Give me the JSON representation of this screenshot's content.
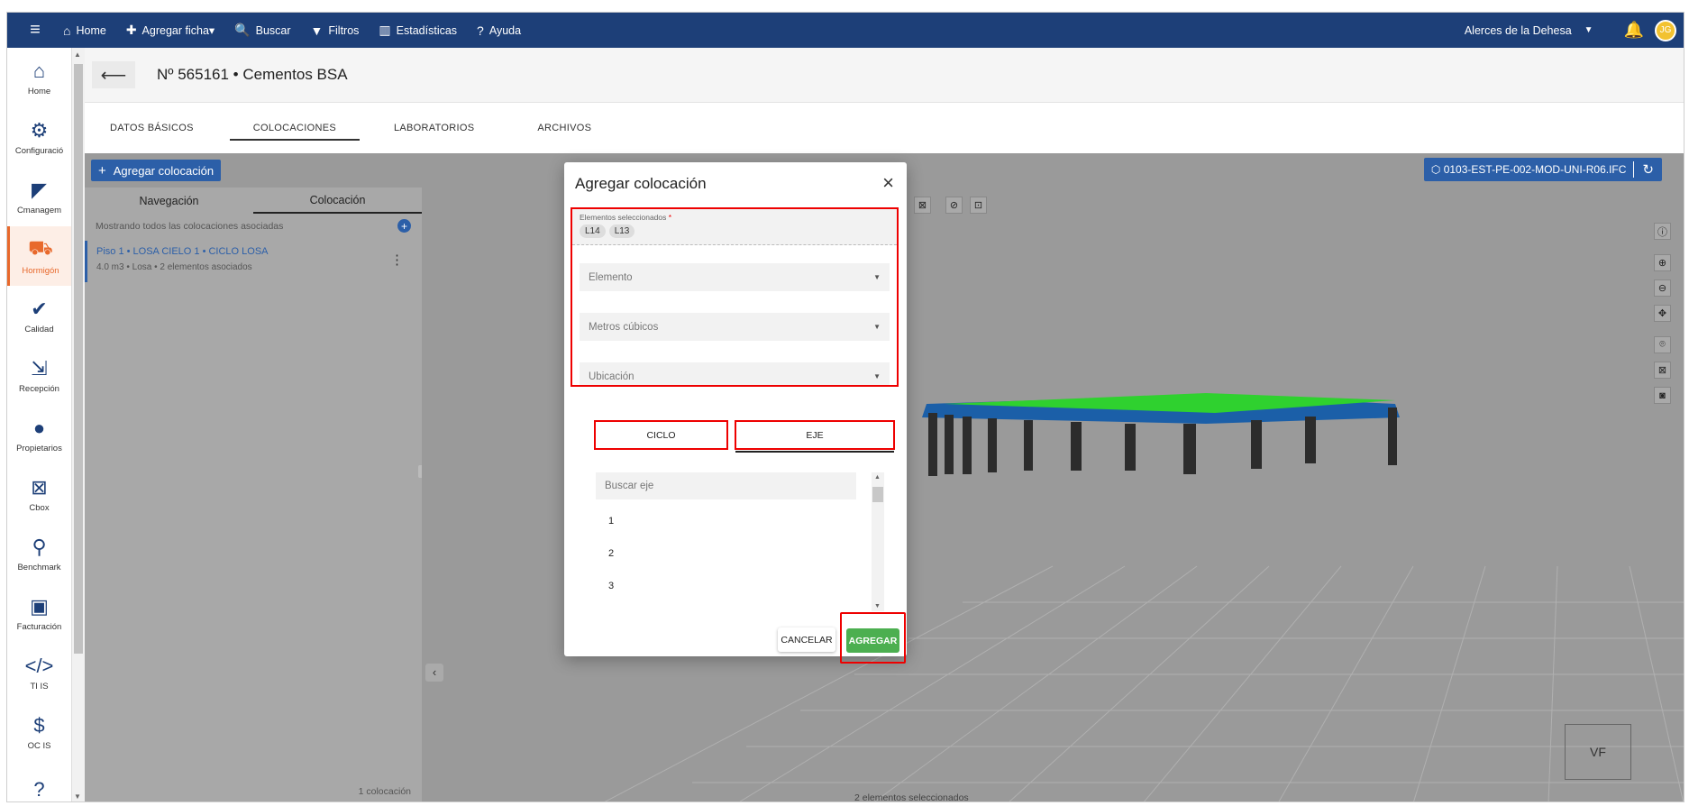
{
  "topbar": {
    "items": [
      {
        "icon": "home-icon",
        "glyph": "⌂",
        "label": "Home"
      },
      {
        "icon": "plus-icon",
        "glyph": "✚",
        "label": "Agregar ficha"
      },
      {
        "icon": "search-icon",
        "glyph": "🔍",
        "label": "Buscar"
      },
      {
        "icon": "filter-icon",
        "glyph": "▼",
        "label": "Filtros"
      },
      {
        "icon": "stats-icon",
        "glyph": "▥",
        "label": "Estadísticas"
      },
      {
        "icon": "help-icon",
        "glyph": "?",
        "label": "Ayuda"
      }
    ],
    "project": "Alerces de la Dehesa",
    "avatar": "JG"
  },
  "sidebar": {
    "items": [
      {
        "icon": "home-icon",
        "glyph": "⌂",
        "label": "Home"
      },
      {
        "icon": "gear-icon",
        "glyph": "⚙",
        "label": "Configuració"
      },
      {
        "icon": "cmanagement-icon",
        "glyph": "◤",
        "label": "Cmanagem"
      },
      {
        "icon": "wheelbarrow-icon",
        "glyph": "⛟",
        "label": "Hormigón",
        "active": true
      },
      {
        "icon": "check-icon",
        "glyph": "✔",
        "label": "Calidad"
      },
      {
        "icon": "reception-icon",
        "glyph": "⇲",
        "label": "Recepción"
      },
      {
        "icon": "owner-icon",
        "glyph": "●",
        "label": "Propietarios"
      },
      {
        "icon": "cbox-icon",
        "glyph": "⊠",
        "label": "Cbox"
      },
      {
        "icon": "benchmark-icon",
        "glyph": "⚲",
        "label": "Benchmark"
      },
      {
        "icon": "billing-icon",
        "glyph": "▣",
        "label": "Facturación"
      },
      {
        "icon": "code-icon",
        "glyph": "</>",
        "label": "TI IS"
      },
      {
        "icon": "dollar-icon",
        "glyph": "$",
        "label": "OC IS"
      },
      {
        "icon": "help-icon",
        "glyph": "?",
        "label": ""
      }
    ]
  },
  "header": {
    "title": "Nº 565161 • Cementos BSA"
  },
  "tabs": [
    "DATOS BÁSICOS",
    "COLOCACIONES",
    "LABORATORIOS",
    "ARCHIVOS"
  ],
  "toolbar": {
    "add_label": "Agregar colocación",
    "model_name": "0103-EST-PE-002-MOD-UNI-R06.IFC"
  },
  "panel": {
    "tabs": [
      "Navegación",
      "Colocación"
    ],
    "info": "Mostrando todos las colocaciones asociadas",
    "item_title": "Piso 1 • LOSA CIELO 1 • CICLO LOSA",
    "item_sub": "4.0 m3 • Losa • 2 elementos asociados",
    "footer": "1 colocación"
  },
  "viewer": {
    "footer": "2 elementos seleccionados",
    "cube": "VF"
  },
  "modal": {
    "title": "Agregar colocación",
    "selected_label": "Elementos seleccionados",
    "required_mark": "*",
    "chips": [
      "L14",
      "L13"
    ],
    "fields": [
      "Elemento",
      "Metros cúbicos",
      "Ubicación"
    ],
    "toggle": {
      "ciclo": "CICLO",
      "eje": "EJE"
    },
    "search_placeholder": "Buscar eje",
    "list": [
      "1",
      "2",
      "3"
    ],
    "cancel": "CANCELAR",
    "submit": "AGREGAR"
  },
  "colors": {
    "nav": "#1d3f78",
    "accent": "#2c5fa8",
    "active": "#e8692c",
    "submit": "#4caf50",
    "highlight": "#e00000"
  }
}
